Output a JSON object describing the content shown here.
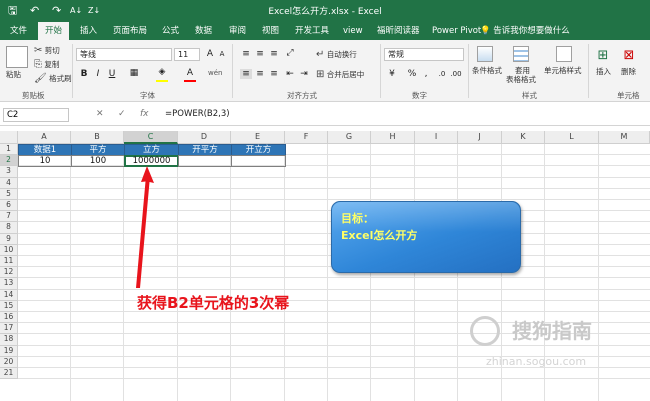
{
  "window": {
    "title": "Excel怎么开方.xlsx  -  Excel"
  },
  "quick_access": {
    "save": "🖫",
    "undo": "↶",
    "redo": "↷",
    "sort_a": "A↓",
    "sort_z": "Z↓"
  },
  "tabs": [
    {
      "label": "文件"
    },
    {
      "label": "开始"
    },
    {
      "label": "插入"
    },
    {
      "label": "页面布局"
    },
    {
      "label": "公式"
    },
    {
      "label": "数据"
    },
    {
      "label": "审阅"
    },
    {
      "label": "视图"
    },
    {
      "label": "开发工具"
    },
    {
      "label": "view"
    },
    {
      "label": "福昕阅读器"
    },
    {
      "label": "Power Pivot"
    }
  ],
  "tell_me": "💡 告诉我你想要做什么",
  "ribbon": {
    "clipboard": {
      "paste": "粘贴",
      "cut": "剪切",
      "copy": "复制",
      "format_painter": "格式刷",
      "label": "剪贴板"
    },
    "font": {
      "name": "等线",
      "size": "11",
      "bold": "B",
      "italic": "I",
      "underline": "U",
      "label": "字体",
      "grow": "A",
      "shrink": "A",
      "fill_color": "#ffff00",
      "font_color": "#ff0000"
    },
    "alignment": {
      "wrap": "自动换行",
      "merge": "合并后居中",
      "label": "对齐方式"
    },
    "number": {
      "format": "常规",
      "currency": "¥",
      "percent": "%",
      "comma": ",",
      "label": "数字"
    },
    "styles": {
      "conditional": "条件格式",
      "table": "套用",
      "table2": "表格格式",
      "cell": "单元格样式",
      "label": "样式"
    },
    "cells": {
      "insert": "插入",
      "delete": "删除",
      "label": "单元格"
    }
  },
  "formula_bar": {
    "name_box": "C2",
    "cancel": "✕",
    "enter": "✓",
    "fx": "fx",
    "formula": "=POWER(B2,3)"
  },
  "columns": [
    "A",
    "B",
    "C",
    "D",
    "E",
    "F",
    "G",
    "H",
    "I",
    "J",
    "K",
    "L",
    "M"
  ],
  "rows": [
    "1",
    "2",
    "3",
    "4",
    "5",
    "6",
    "7",
    "8",
    "9",
    "10",
    "11",
    "12",
    "13",
    "14",
    "15",
    "16",
    "17",
    "18",
    "19",
    "20",
    "21"
  ],
  "table": {
    "headers": [
      "数据1",
      "平方",
      "立方",
      "开平方",
      "开立方"
    ],
    "row2": [
      "10",
      "100",
      "1000000",
      "",
      ""
    ]
  },
  "callout": {
    "line1": "目标：",
    "line2": "Excel怎么开方"
  },
  "annotation": "获得B2单元格的3次幂",
  "watermark": {
    "main": "搜狗指南",
    "sub": "zhinan.sogou.com"
  }
}
